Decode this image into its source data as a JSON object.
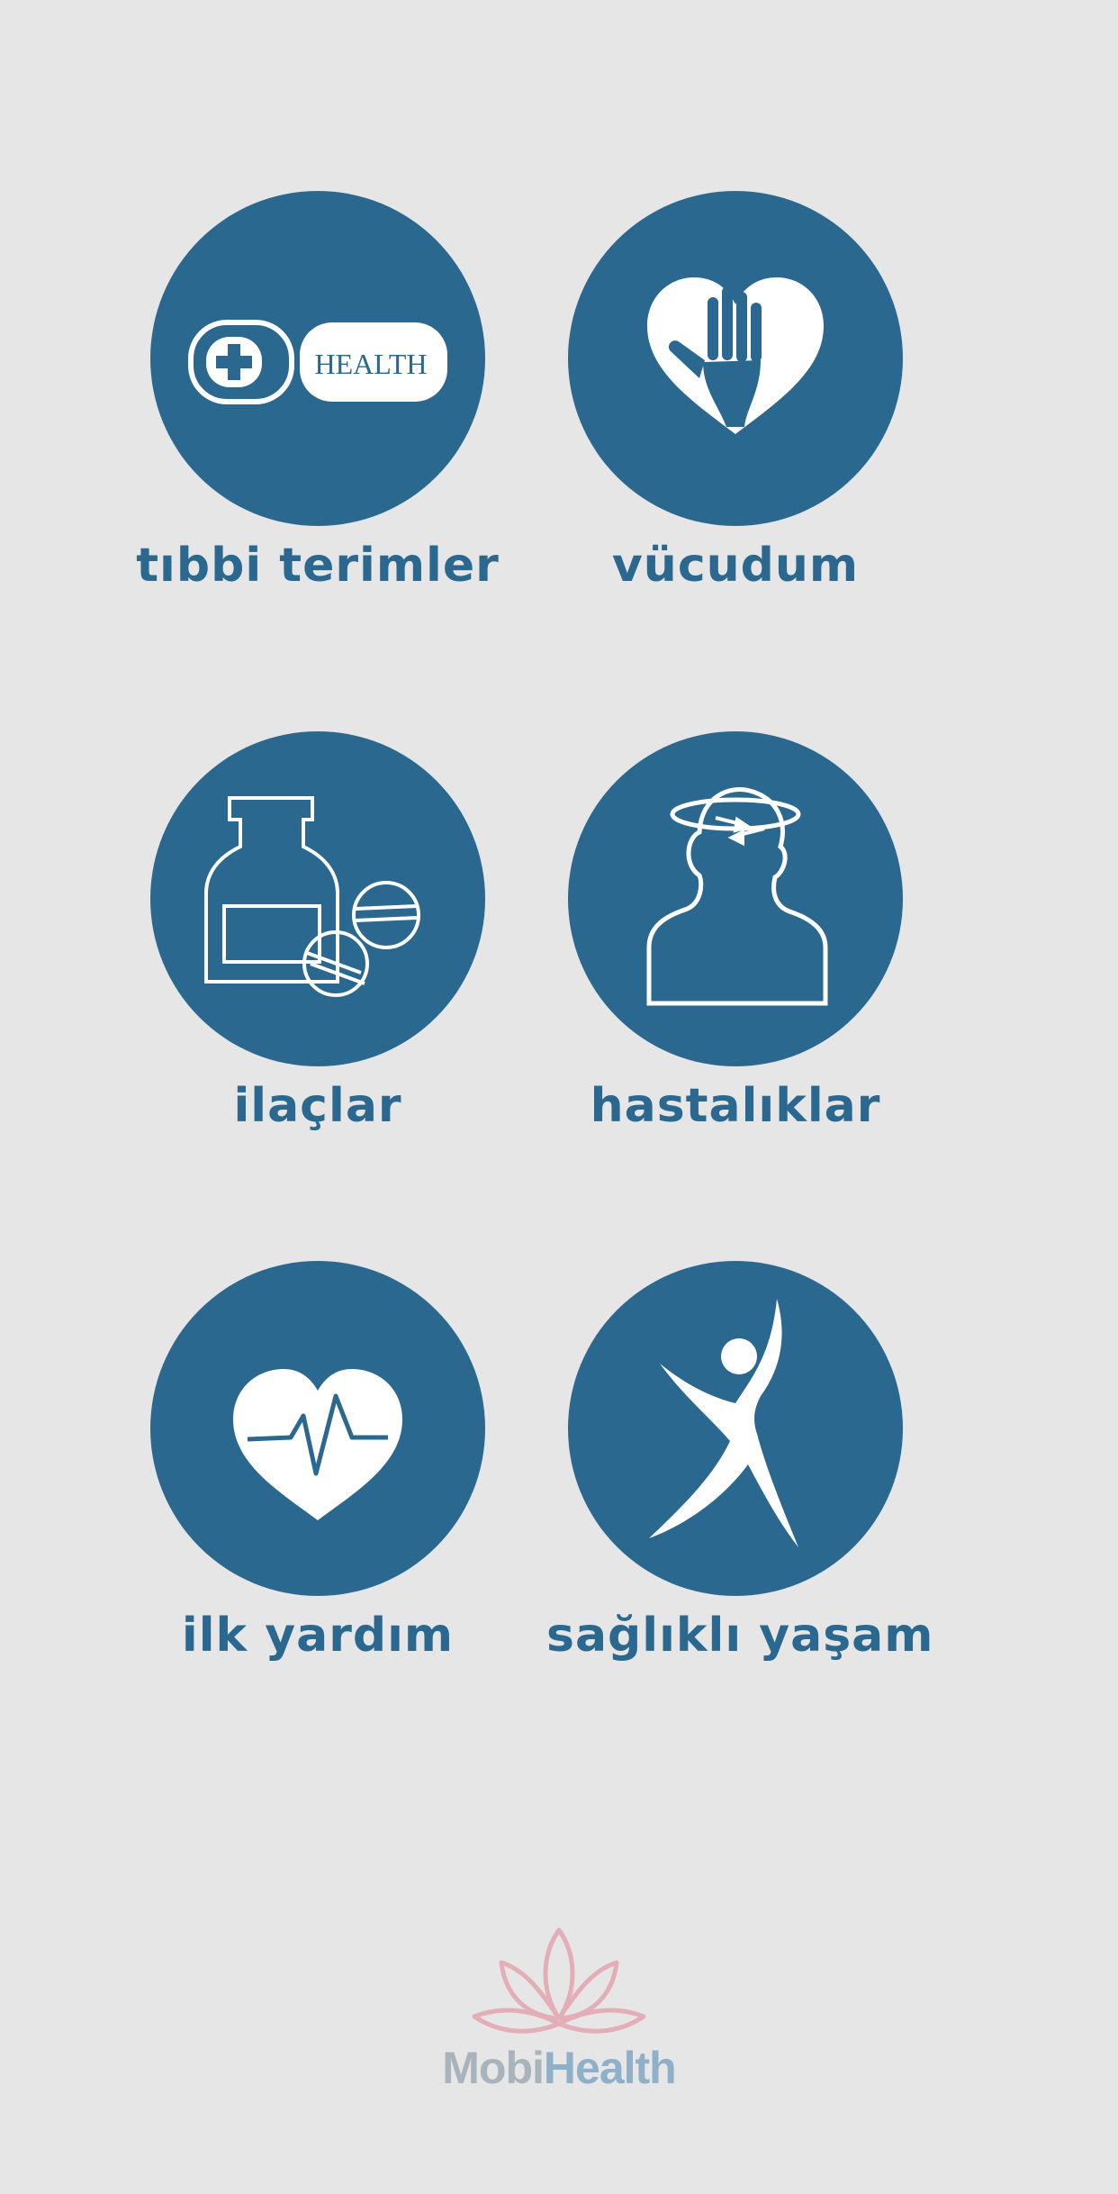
{
  "menu": {
    "items": [
      {
        "label": "tıbbi terimler",
        "icon": "health-card-icon"
      },
      {
        "label": "vücudum",
        "icon": "heart-hand-icon"
      },
      {
        "label": "ilaçlar",
        "icon": "medicine-bottle-pills-icon"
      },
      {
        "label": "hastalıklar",
        "icon": "dizzy-head-icon"
      },
      {
        "label": "ilk yardım",
        "icon": "heartbeat-icon"
      },
      {
        "label": "sağlıklı yaşam",
        "icon": "active-person-icon"
      }
    ]
  },
  "card_icon_text": "HEALTH",
  "brand": {
    "name_part1": "Mobi",
    "name_part2": "Health"
  },
  "colors": {
    "background": "#e6e6e6",
    "accent": "#2a6890",
    "logo_flower": "#e3aeb6",
    "logo_mobi": "#a9b3bc",
    "logo_health": "#8fb0c9"
  }
}
